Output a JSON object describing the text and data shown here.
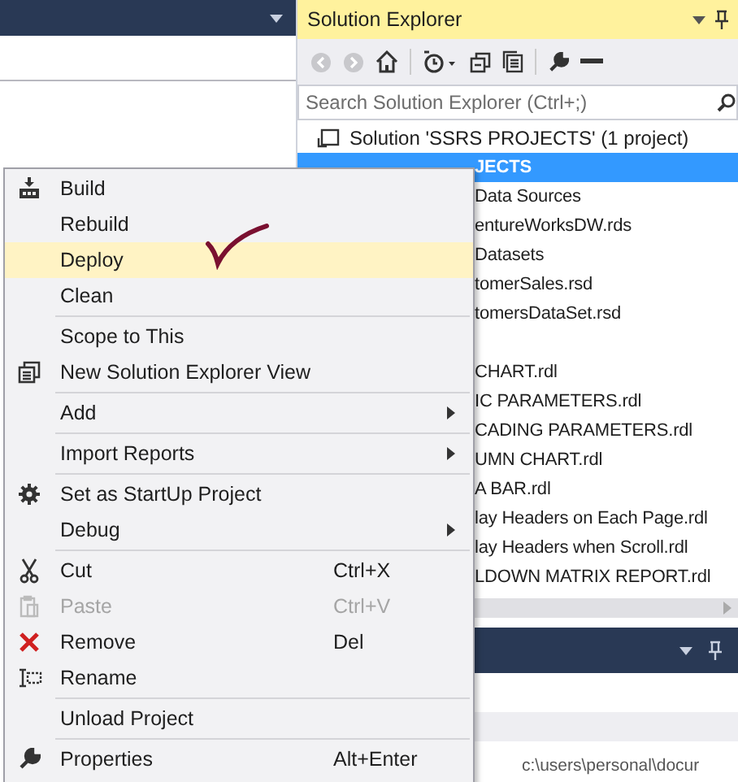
{
  "solution_explorer": {
    "title": "Solution Explorer",
    "search": {
      "placeholder": "Search Solution Explorer (Ctrl+;)"
    },
    "tree": [
      {
        "label": "Solution 'SSRS PROJECTS' (1 project)",
        "selected": false,
        "children": [
          {
            "label": "JECTS",
            "selected": true,
            "children": [
              {
                "label": "Data Sources",
                "selected": false,
                "children": [
                  {
                    "label": "entureWorksDW.rds",
                    "selected": false
                  }
                ]
              },
              {
                "label": "Datasets",
                "selected": false,
                "children": [
                  {
                    "label": "tomerSales.rsd",
                    "selected": false
                  },
                  {
                    "label": "tomersDataSet.rsd",
                    "selected": false
                  }
                ]
              }
            ],
            "report_files": [
              {
                "label": "CHART.rdl",
                "selected": false
              },
              {
                "label": "IC PARAMETERS.rdl",
                "selected": false
              },
              {
                "label": "CADING PARAMETERS.rdl",
                "selected": false
              },
              {
                "label": "UMN CHART.rdl",
                "selected": false
              },
              {
                "label": "A BAR.rdl",
                "selected": false
              },
              {
                "label": "lay Headers on Each Page.rdl",
                "selected": false
              },
              {
                "label": "lay Headers when Scroll.rdl",
                "selected": false
              },
              {
                "label": "LDOWN MATRIX REPORT.rdl",
                "selected": false
              }
            ]
          }
        ]
      }
    ]
  },
  "output_panel": {
    "path": "c:\\users\\personal\\docur"
  },
  "context_menu": [
    {
      "kind": "build",
      "label": "Build",
      "selected": false,
      "disabled": false,
      "submenu": false
    },
    {
      "kind": "plain",
      "label": "Rebuild",
      "selected": false,
      "disabled": false,
      "submenu": false
    },
    {
      "kind": "plain",
      "label": "Deploy",
      "selected": true,
      "disabled": false,
      "submenu": false
    },
    {
      "kind": "plain",
      "label": "Clean",
      "selected": false,
      "disabled": false,
      "submenu": false
    },
    {
      "kind": "separator"
    },
    {
      "kind": "plain",
      "label": "Scope to This",
      "selected": false,
      "disabled": false,
      "submenu": false
    },
    {
      "kind": "view",
      "label": "New Solution Explorer View",
      "selected": false,
      "disabled": false,
      "submenu": false
    },
    {
      "kind": "separator"
    },
    {
      "kind": "plain",
      "label": "Add",
      "selected": false,
      "disabled": false,
      "submenu": true
    },
    {
      "kind": "separator"
    },
    {
      "kind": "plain",
      "label": "Import Reports",
      "selected": false,
      "disabled": false,
      "submenu": true
    },
    {
      "kind": "separator"
    },
    {
      "kind": "settings",
      "label": "Set as StartUp Project",
      "selected": false,
      "disabled": false,
      "submenu": false
    },
    {
      "kind": "plain",
      "label": "Debug",
      "selected": false,
      "disabled": false,
      "submenu": true
    },
    {
      "kind": "separator"
    },
    {
      "kind": "cut",
      "label": "Cut",
      "shortcut": "Ctrl+X",
      "selected": false,
      "disabled": false,
      "submenu": false
    },
    {
      "kind": "paste",
      "label": "Paste",
      "shortcut": "Ctrl+V",
      "selected": false,
      "disabled": true,
      "submenu": false
    },
    {
      "kind": "remove",
      "label": "Remove",
      "shortcut": "Del",
      "selected": false,
      "disabled": false,
      "submenu": false
    },
    {
      "kind": "rename",
      "label": "Rename",
      "selected": false,
      "disabled": false,
      "submenu": false
    },
    {
      "kind": "separator"
    },
    {
      "kind": "plain",
      "label": "Unload Project",
      "selected": false,
      "disabled": false,
      "submenu": false
    },
    {
      "kind": "separator"
    },
    {
      "kind": "properties",
      "label": "Properties",
      "shortcut": "Alt+Enter",
      "selected": false,
      "disabled": false,
      "submenu": false
    }
  ]
}
